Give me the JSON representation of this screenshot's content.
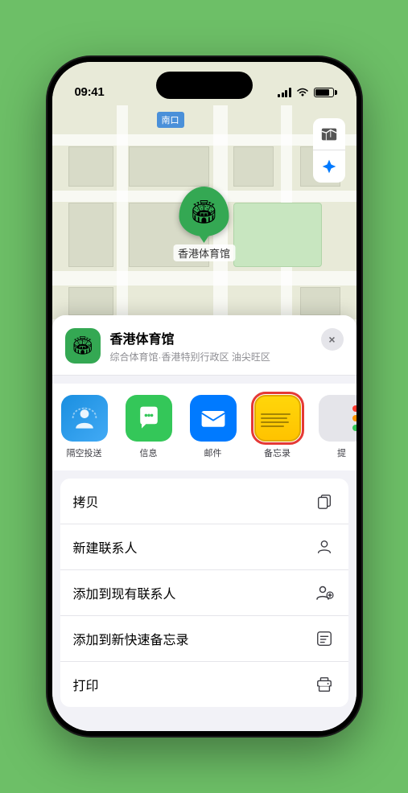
{
  "status_bar": {
    "time": "09:41",
    "location_arrow": "▶"
  },
  "map": {
    "label": "南口",
    "marker_label": "香港体育馆",
    "controls": {
      "map_icon": "🗺",
      "location_icon": "➤"
    }
  },
  "place_card": {
    "name": "香港体育馆",
    "description": "综合体育馆·香港特别行政区 油尖旺区",
    "close_label": "×"
  },
  "share_row": {
    "items": [
      {
        "id": "airdrop",
        "label": "隔空投送",
        "type": "airdrop"
      },
      {
        "id": "messages",
        "label": "信息",
        "type": "messages"
      },
      {
        "id": "mail",
        "label": "邮件",
        "type": "mail"
      },
      {
        "id": "notes",
        "label": "备忘录",
        "type": "notes",
        "selected": true
      },
      {
        "id": "more",
        "label": "提",
        "type": "more"
      }
    ]
  },
  "actions": [
    {
      "id": "copy",
      "label": "拷贝",
      "icon": "copy"
    },
    {
      "id": "new-contact",
      "label": "新建联系人",
      "icon": "person"
    },
    {
      "id": "add-existing",
      "label": "添加到现有联系人",
      "icon": "person-add"
    },
    {
      "id": "quick-note",
      "label": "添加到新快速备忘录",
      "icon": "note"
    },
    {
      "id": "print",
      "label": "打印",
      "icon": "print"
    }
  ]
}
